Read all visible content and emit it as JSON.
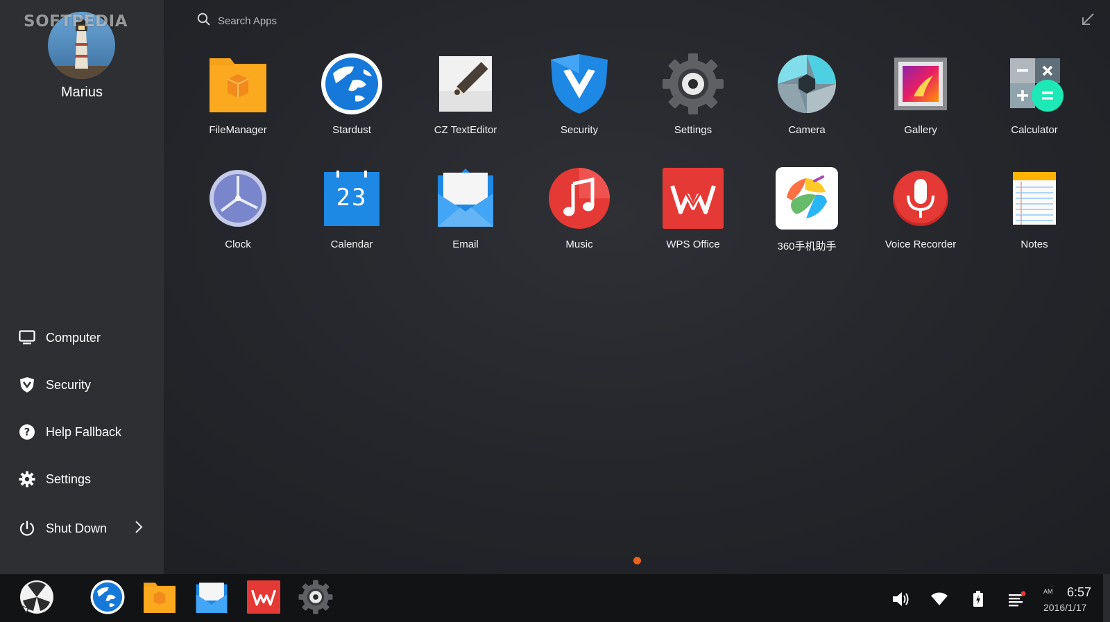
{
  "watermark": "SOFTPEDIA",
  "user": {
    "name": "Marius"
  },
  "search": {
    "placeholder": "Search Apps"
  },
  "sidebar": {
    "items": [
      {
        "label": "Computer",
        "icon": "monitor-icon"
      },
      {
        "label": "Security",
        "icon": "shield-icon"
      },
      {
        "label": "Help Fallback",
        "icon": "help-icon"
      },
      {
        "label": "Settings",
        "icon": "gear-icon"
      },
      {
        "label": "Shut Down",
        "icon": "power-icon"
      }
    ]
  },
  "apps": [
    {
      "label": "FileManager",
      "icon": "file-manager-icon"
    },
    {
      "label": "Stardust",
      "icon": "stardust-browser-icon"
    },
    {
      "label": "CZ TextEditor",
      "icon": "text-editor-icon"
    },
    {
      "label": "Security",
      "icon": "security-shield-icon"
    },
    {
      "label": "Settings",
      "icon": "settings-gear-icon"
    },
    {
      "label": "Camera",
      "icon": "camera-aperture-icon"
    },
    {
      "label": "Gallery",
      "icon": "gallery-icon"
    },
    {
      "label": "Calculator",
      "icon": "calculator-icon"
    },
    {
      "label": "Clock",
      "icon": "clock-icon"
    },
    {
      "label": "Calendar",
      "icon": "calendar-icon",
      "day": "23"
    },
    {
      "label": "Email",
      "icon": "email-icon"
    },
    {
      "label": "Music",
      "icon": "music-note-icon"
    },
    {
      "label": "WPS Office",
      "icon": "wps-office-icon"
    },
    {
      "label": "360手机助手",
      "icon": "360-assistant-icon"
    },
    {
      "label": "Voice Recorder",
      "icon": "microphone-icon"
    },
    {
      "label": "Notes",
      "icon": "notes-icon"
    }
  ],
  "pagination": {
    "current": 1,
    "total": 1
  },
  "taskbar": {
    "pinned": [
      "start-menu-icon",
      "stardust-browser-icon",
      "file-manager-icon",
      "email-icon",
      "wps-office-icon",
      "settings-gear-icon"
    ],
    "tray": [
      "volume-icon",
      "wifi-icon",
      "battery-charging-icon",
      "notifications-icon"
    ],
    "clock": {
      "ampm": "AM",
      "time": "6:57",
      "date": "2016/1/17"
    }
  },
  "colors": {
    "accent": "#e8631c",
    "sidebar_bg": "#2d2f33",
    "taskbar_bg": "#121315",
    "notification_dot": "#e53935"
  }
}
